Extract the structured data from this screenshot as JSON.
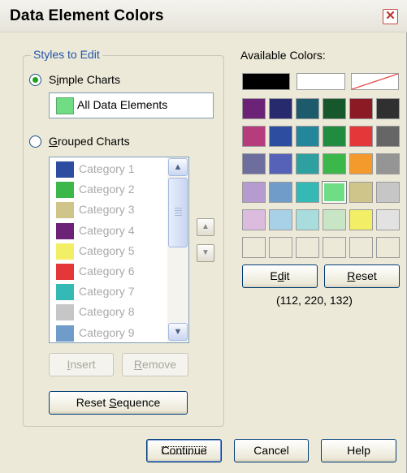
{
  "window": {
    "title": "Data Element Colors",
    "close_glyph": "✕"
  },
  "styles_group": {
    "legend": "Styles to Edit",
    "simple_charts": {
      "label": "Simple Charts",
      "mnemonic_index": 1,
      "selected": true
    },
    "all_data_elements": {
      "label": "All Data Elements",
      "color": "#70dc84"
    },
    "grouped_charts": {
      "label": "Grouped Charts",
      "mnemonic_index": 0,
      "selected": false
    },
    "categories": [
      {
        "label": "Category 1",
        "color": "#2d4ea0"
      },
      {
        "label": "Category 2",
        "color": "#3cb84a"
      },
      {
        "label": "Category 3",
        "color": "#cfc48a"
      },
      {
        "label": "Category 4",
        "color": "#6c2377"
      },
      {
        "label": "Category 5",
        "color": "#f2ee66"
      },
      {
        "label": "Category 6",
        "color": "#e4373a"
      },
      {
        "label": "Category 7",
        "color": "#35b9b5"
      },
      {
        "label": "Category 8",
        "color": "#c6c6c6"
      },
      {
        "label": "Category 9",
        "color": "#6f9cc9"
      }
    ],
    "scroll_up_glyph": "▲",
    "scroll_down_glyph": "▼",
    "move_up_glyph": "▲",
    "move_down_glyph": "▼",
    "insert_label": "Insert",
    "remove_label": "Remove",
    "reset_sequence_label": "Reset Sequence"
  },
  "available_colors": {
    "label": "Available Colors:",
    "top_row": [
      {
        "name": "black",
        "color": "#000000"
      },
      {
        "name": "white",
        "color": "#ffffff"
      },
      {
        "name": "none",
        "color": "transparent"
      }
    ],
    "grid": [
      [
        "#6c2377",
        "#272a6c",
        "#1d5a6c",
        "#16572c",
        "#8c1a24",
        "#303030"
      ],
      [
        "#b63c7c",
        "#2d4ea0",
        "#23869a",
        "#1f8c3f",
        "#e4373a",
        "#666666"
      ],
      [
        "#6d6e9e",
        "#5661b8",
        "#2ea09f",
        "#3cb84a",
        "#f49a2c",
        "#959595"
      ],
      [
        "#b69bd0",
        "#6f9cc9",
        "#35b9b5",
        "#70dc84",
        "#cfc48a",
        "#c6c6c6"
      ],
      [
        "#dbbcdf",
        "#a8d0e6",
        "#a8dcdd",
        "#c8e6c6",
        "#f2ee66",
        "#e2e2e2"
      ],
      [
        "#ece9d8",
        "#ece9d8",
        "#ece9d8",
        "#ece9d8",
        "#ece9d8",
        "#ece9d8"
      ]
    ],
    "selected_row": 3,
    "selected_col": 3,
    "edit_label": "Edit",
    "reset_label": "Reset",
    "rgb_text": "(112, 220, 132)"
  },
  "footer": {
    "continue_label": "Continue",
    "cancel_label": "Cancel",
    "help_label": "Help"
  }
}
